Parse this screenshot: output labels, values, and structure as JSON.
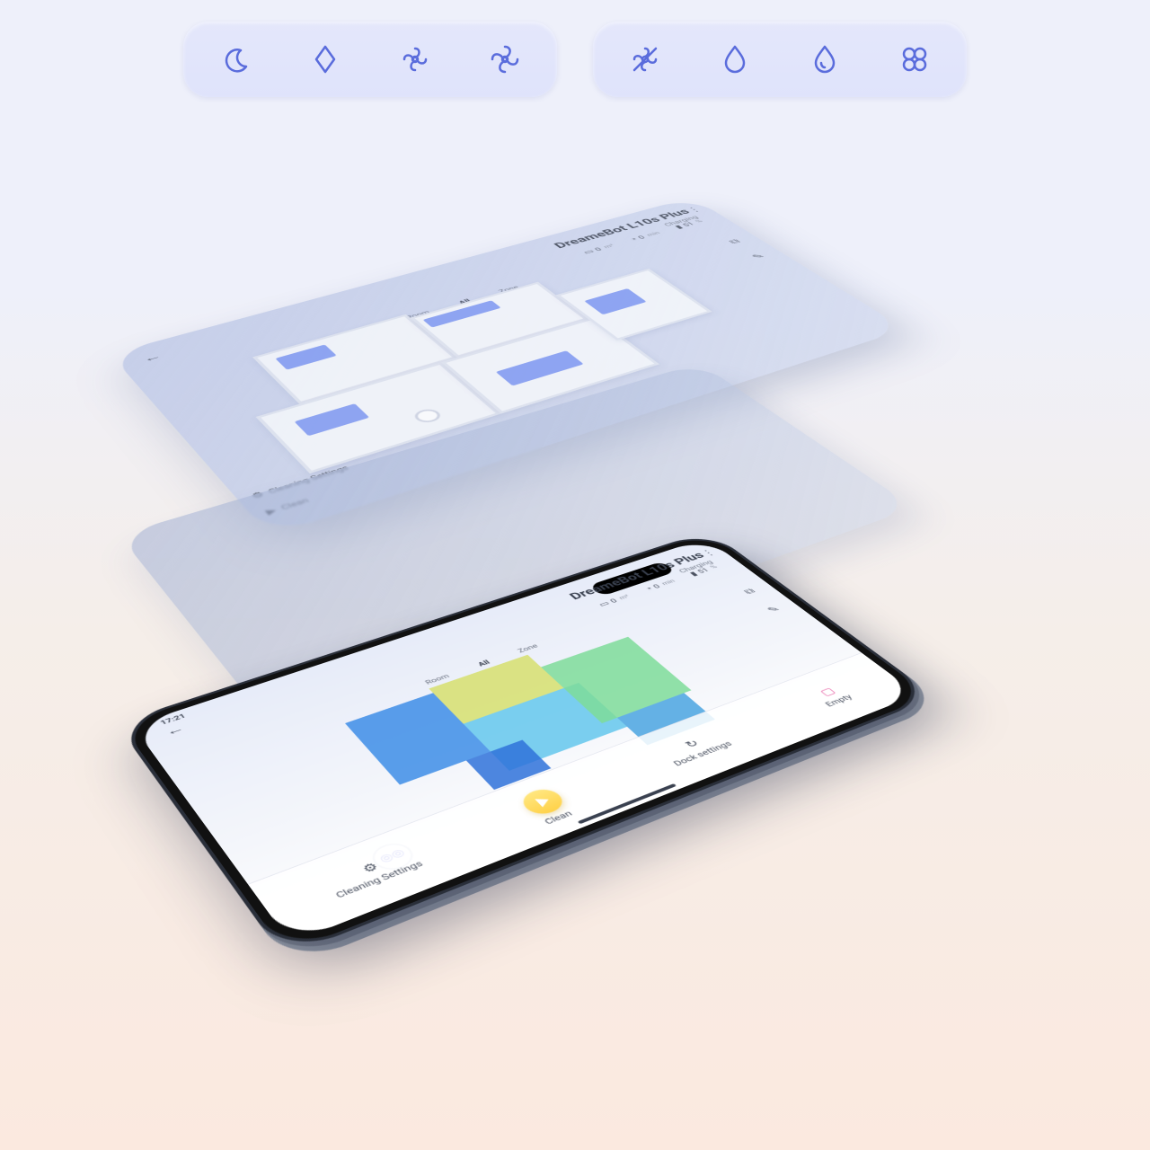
{
  "suction_pill": {
    "icons": [
      "moon-icon",
      "power-low-icon",
      "fan-medium-icon",
      "fan-high-icon"
    ]
  },
  "mop_pill": {
    "icons": [
      "fan-off-icon",
      "water-low-icon",
      "water-high-icon",
      "clover-icon"
    ]
  },
  "app": {
    "title": "DreameBot L10s Plus",
    "subtitle": "Charging",
    "back": "←",
    "menu": "⋮",
    "time": "17:21",
    "stats": {
      "area_value": "0",
      "area_unit": "m²",
      "time_value": "0",
      "time_unit": "min",
      "battery_value": "51",
      "battery_unit": "%"
    },
    "tabs": [
      "Room",
      "All",
      "Zone"
    ],
    "tab_selected": 1,
    "side_tools": [
      "map-layers-icon",
      "map-edit-icon"
    ],
    "actions": {
      "settings_label": "Cleaning\nSettings",
      "clean_label": "Clean",
      "dock_label": "Dock settings",
      "empty_label": "Empty"
    }
  }
}
